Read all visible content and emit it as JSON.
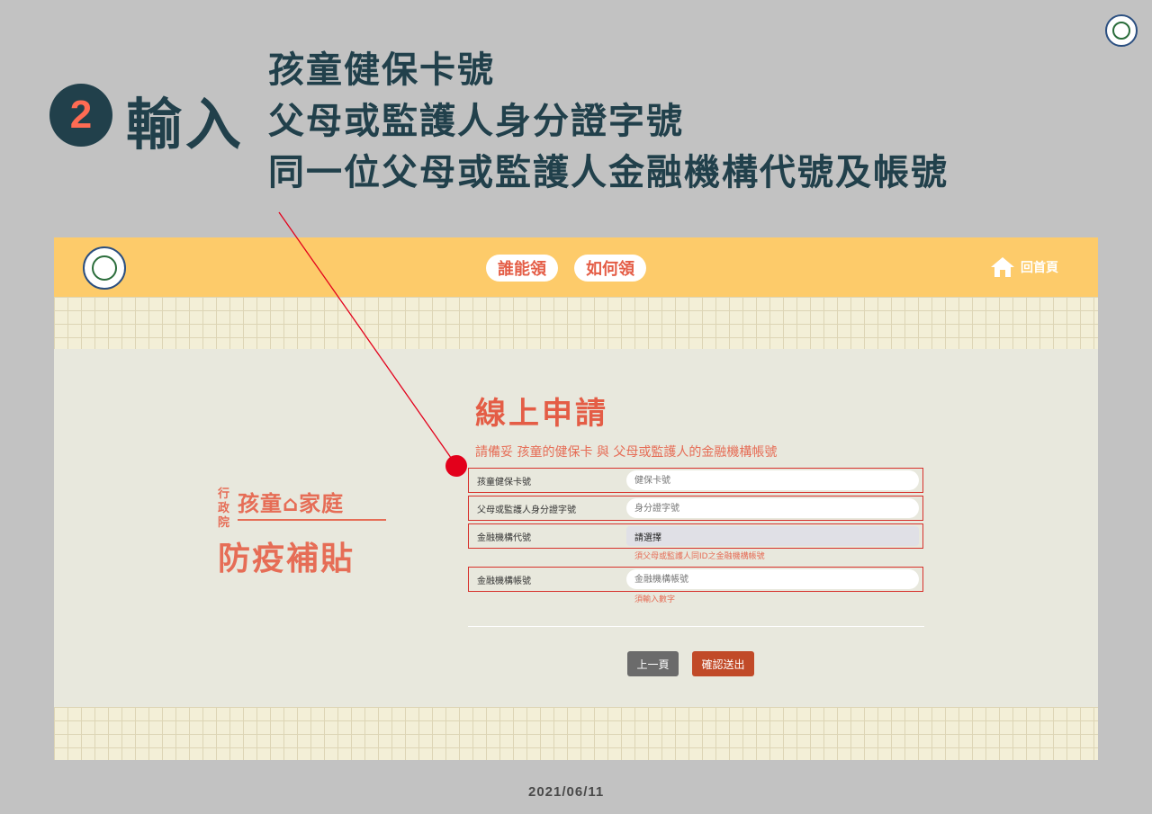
{
  "slide": {
    "step_number": "2",
    "step_verb": "輸入",
    "lines": [
      "孩童健保卡號",
      "父母或監護人身分證字號",
      "同一位父母或監護人金融機構代號及帳號"
    ],
    "date": "2021/06/11"
  },
  "site": {
    "nav": {
      "who": "誰能領",
      "how": "如何領",
      "home": "回首頁"
    },
    "brand": {
      "small": "行政院",
      "line1": "孩童⌂家庭",
      "line2": "防疫補貼"
    },
    "form": {
      "title": "線上申請",
      "subtitle": "請備妥 孩童的健保卡 與 父母或監護人的金融機構帳號",
      "fields": [
        {
          "label": "孩童健保卡號",
          "placeholder": "健保卡號"
        },
        {
          "label": "父母或監護人身分證字號",
          "placeholder": "身分證字號"
        },
        {
          "label": "金融機構代號",
          "value": "請選擇",
          "hint": "須父母或監護人同ID之金融機構帳號"
        },
        {
          "label": "金融機構帳號",
          "placeholder": "金融機構帳號",
          "hint": "須輸入數字"
        }
      ],
      "prev_button": "上一頁",
      "submit_button": "確認送出"
    }
  },
  "colors": {
    "accent": "#e45d46",
    "header": "#fdcb6a",
    "dark": "#21404b",
    "marker": "#e3001b"
  }
}
